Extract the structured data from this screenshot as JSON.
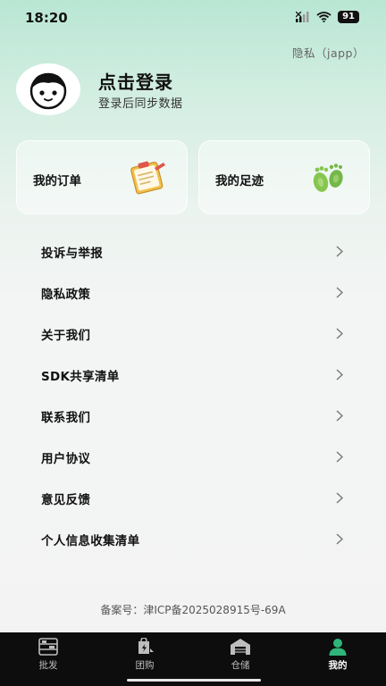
{
  "status_bar": {
    "time": "18:20",
    "battery": "91"
  },
  "header": {
    "privacy_link": "隐私（japp）",
    "login_title": "点击登录",
    "login_subtitle": "登录后同步数据"
  },
  "cards": [
    {
      "label": "我的订单",
      "icon": "clipboard-icon"
    },
    {
      "label": "我的足迹",
      "icon": "footprints-icon"
    }
  ],
  "menu": [
    {
      "label": "投诉与举报"
    },
    {
      "label": "隐私政策"
    },
    {
      "label": "关于我们"
    },
    {
      "label": "SDK共享清单"
    },
    {
      "label": "联系我们"
    },
    {
      "label": "用户协议"
    },
    {
      "label": "意见反馈"
    },
    {
      "label": "个人信息收集清单"
    }
  ],
  "icp": "备案号：津ICP备2025028915号-69A",
  "tabs": [
    {
      "label": "批发",
      "icon": "warehouse-shelf-icon",
      "active": false
    },
    {
      "label": "团购",
      "icon": "bag-icon",
      "active": false
    },
    {
      "label": "仓储",
      "icon": "storage-icon",
      "active": false
    },
    {
      "label": "我的",
      "icon": "user-icon",
      "active": true
    }
  ],
  "colors": {
    "accent": "#2fb57a",
    "tabbar_bg": "#0d0d0d",
    "background_top": "#b9e6d4"
  }
}
